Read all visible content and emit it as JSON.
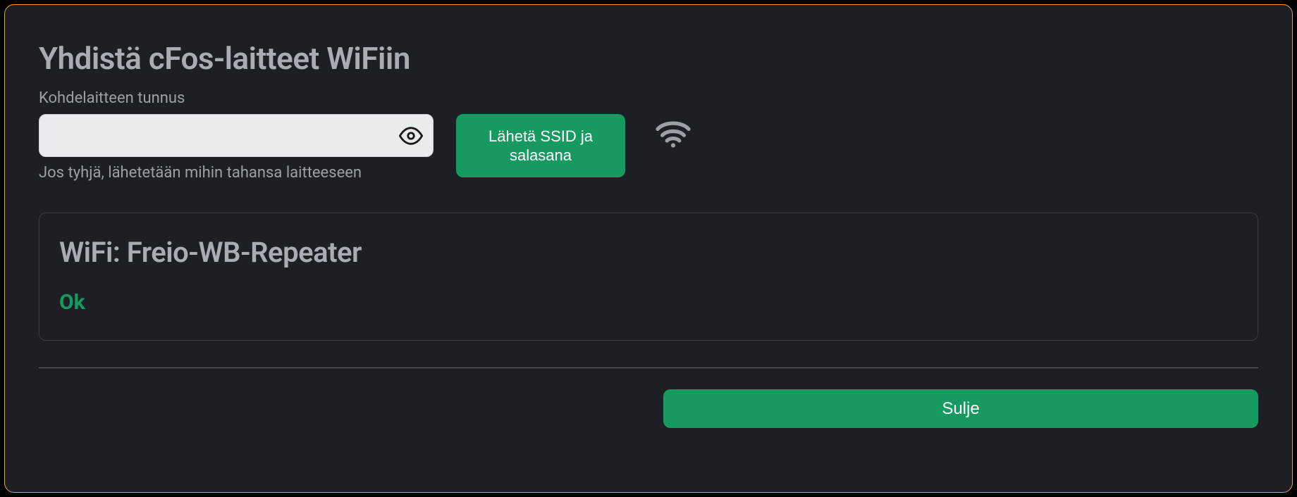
{
  "modal": {
    "title": "Yhdistä cFos-laitteet WiFiin",
    "device_id_label": "Kohdelaitteen tunnus",
    "device_id_value": "",
    "device_id_helper": "Jos tyhjä, lähetetään mihin tahansa laitteeseen",
    "send_button": "Lähetä SSID ja salasana",
    "status": {
      "wifi_label": "WiFi: Freio-WB-Repeater",
      "ok_label": "Ok"
    },
    "close_button": "Sulje"
  },
  "icons": {
    "eye": "eye-icon",
    "wifi": "wifi-icon"
  },
  "colors": {
    "accent": "#169a5f",
    "modal_border": "#e8a63b",
    "background": "#1c1f23",
    "muted_text": "#9ba0a6"
  }
}
